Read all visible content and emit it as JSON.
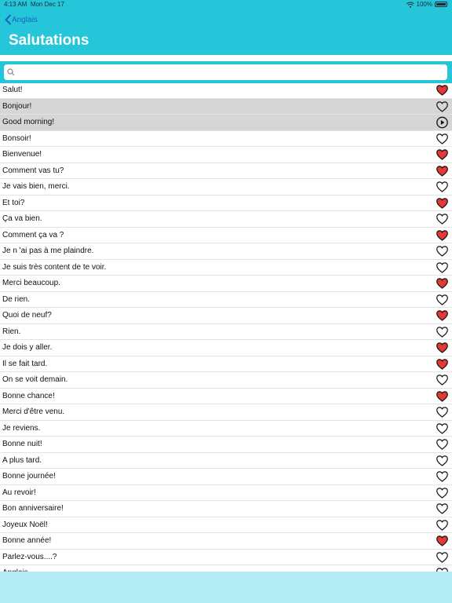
{
  "status": {
    "time": "4:13 AM",
    "date": "Mon Dec 17",
    "battery": "100%"
  },
  "nav": {
    "back_label": "Anglais",
    "title": "Salutations"
  },
  "search": {
    "placeholder": ""
  },
  "colors": {
    "header": "#26c6da",
    "bottom_bar": "#b3ecf4",
    "favorite": "#e53935",
    "back": "#1565c0"
  },
  "phrases": [
    {
      "text": "Salut!",
      "icon": "heart-filled"
    },
    {
      "text": "Bonjour!",
      "icon": "heart-outline",
      "selected": true
    },
    {
      "text": "Good morning!",
      "icon": "play-circle",
      "selected": true
    },
    {
      "text": "Bonsoir!",
      "icon": "heart-outline"
    },
    {
      "text": "Bienvenue!",
      "icon": "heart-filled"
    },
    {
      "text": "Comment vas tu?",
      "icon": "heart-filled"
    },
    {
      "text": "Je vais bien, merci.",
      "icon": "heart-outline"
    },
    {
      "text": "Et toi?",
      "icon": "heart-filled"
    },
    {
      "text": "Ça va bien.",
      "icon": "heart-outline"
    },
    {
      "text": "Comment ça va ?",
      "icon": "heart-filled"
    },
    {
      "text": "Je n 'ai pas à me plaindre.",
      "icon": "heart-outline"
    },
    {
      "text": "Je suis très content de te voir.",
      "icon": "heart-outline"
    },
    {
      "text": "Merci beaucoup.",
      "icon": "heart-filled"
    },
    {
      "text": "De rien.",
      "icon": "heart-outline"
    },
    {
      "text": "Quoi de neuf?",
      "icon": "heart-filled"
    },
    {
      "text": "Rien.",
      "icon": "heart-outline"
    },
    {
      "text": "Je dois y aller.",
      "icon": "heart-filled"
    },
    {
      "text": "Il se fait tard.",
      "icon": "heart-filled"
    },
    {
      "text": "On se voit demain.",
      "icon": "heart-outline"
    },
    {
      "text": "Bonne chance!",
      "icon": "heart-filled"
    },
    {
      "text": "Merci d'être venu.",
      "icon": "heart-outline"
    },
    {
      "text": "Je reviens.",
      "icon": "heart-outline"
    },
    {
      "text": "Bonne nuit!",
      "icon": "heart-outline"
    },
    {
      "text": "A plus tard.",
      "icon": "heart-outline"
    },
    {
      "text": "Bonne journée!",
      "icon": "heart-outline"
    },
    {
      "text": "Au revoir!",
      "icon": "heart-outline"
    },
    {
      "text": " Bon anniversaire!",
      "icon": "heart-outline"
    },
    {
      "text": "Joyeux Noël!",
      "icon": "heart-outline"
    },
    {
      "text": "Bonne année!",
      "icon": "heart-filled"
    },
    {
      "text": "Parlez-vous....?",
      "icon": "heart-outline"
    },
    {
      "text": "Anglais",
      "icon": "heart-outline"
    }
  ]
}
